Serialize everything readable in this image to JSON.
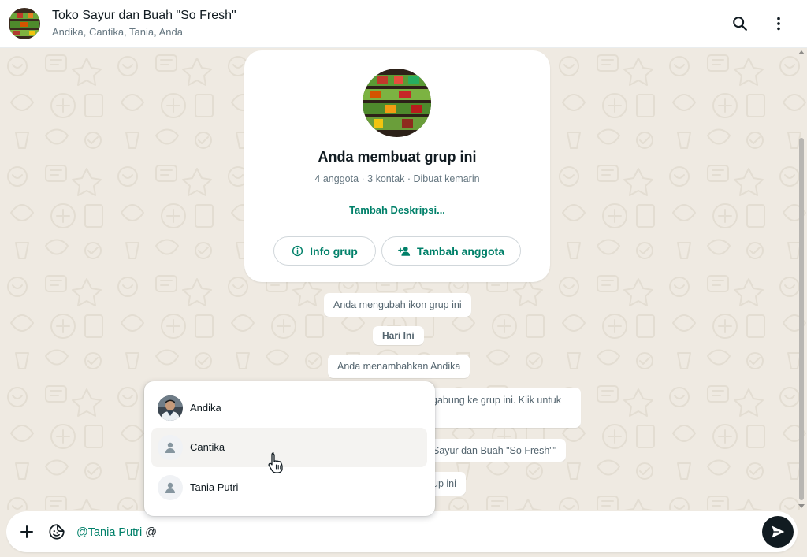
{
  "header": {
    "title": "Toko Sayur dan Buah \"So Fresh\"",
    "members": "Andika, Cantika, Tania, Anda",
    "avatar_icon": "produce-shelf-image",
    "search_icon": "search-icon",
    "menu_icon": "more-vertical-icon"
  },
  "info_card": {
    "title": "Anda membuat grup ini",
    "subtitle": "4 anggota · 3 kontak · Dibuat kemarin",
    "add_description": "Tambah Deskripsi...",
    "info_button": "Info grup",
    "add_member_button": "Tambah anggota"
  },
  "messages": [
    {
      "text": "Anda mengubah ikon grup ini"
    },
    {
      "text": "Hari Ini"
    },
    {
      "text": "Anda menambahkan Andika"
    },
    {
      "text": "gabung ke grup ini. Klik untuk"
    },
    {
      "text": "Sayur dan Buah \"So Fresh\"\""
    },
    {
      "text": "up ini"
    }
  ],
  "mention_list": [
    {
      "name": "Andika",
      "avatar": "photo"
    },
    {
      "name": "Cantika",
      "avatar": "default-person"
    },
    {
      "name": "Tania Putri",
      "avatar": "default-person"
    }
  ],
  "composer": {
    "mention_text": "@Tania Putri",
    "typed_text": " @",
    "attach_icon": "plus-icon",
    "sticker_icon": "sticker-icon",
    "send_icon": "send-icon"
  },
  "colors": {
    "accent": "#008069",
    "background": "#efeae2",
    "send_button": "#111b21"
  }
}
